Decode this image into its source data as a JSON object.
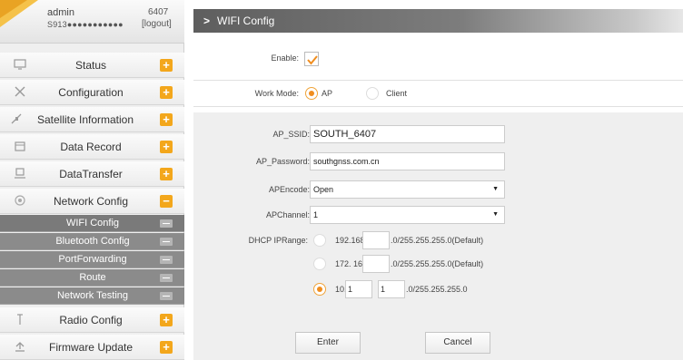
{
  "user": {
    "name": "admin",
    "serial": "S913●●●●●●●●●●●",
    "device_id": "6407",
    "logout_label": "[logout]"
  },
  "sidebar": {
    "items": [
      {
        "label": "Status",
        "icon": "monitor-icon"
      },
      {
        "label": "Configuration",
        "icon": "tools-icon"
      },
      {
        "label": "Satellite Information",
        "icon": "satellite-icon"
      },
      {
        "label": "Data Record",
        "icon": "calendar-icon"
      },
      {
        "label": "DataTransfer",
        "icon": "transfer-icon"
      },
      {
        "label": "Network Config",
        "icon": "globe-icon"
      }
    ],
    "subitems": [
      {
        "label": "WIFI Config"
      },
      {
        "label": "Bluetooth Config"
      },
      {
        "label": "PortForwarding"
      },
      {
        "label": "Route"
      },
      {
        "label": "Network Testing"
      }
    ],
    "bottom_items": [
      {
        "label": "Radio Config",
        "icon": "antenna-icon"
      },
      {
        "label": "Firmware Update",
        "icon": "upload-icon"
      }
    ]
  },
  "page": {
    "title": "WIFI Config",
    "enable_label": "Enable:",
    "enable_checked": true,
    "work_mode_label": "Work Mode:",
    "work_mode_options": [
      "AP",
      "Client"
    ],
    "work_mode_selected": "AP"
  },
  "form": {
    "ssid_label": "AP_SSID:",
    "ssid_value": "SOUTH_6407",
    "password_label": "AP_Password:",
    "password_value": "southgnss.com.cn",
    "encode_label": "APEncode:",
    "encode_value": "Open",
    "channel_label": "APChannel:",
    "channel_value": "1",
    "dhcp_label": "DHCP IPRange:",
    "dhcp_options": [
      {
        "prefix": "192.168.",
        "fields": [
          ""
        ],
        "suffix": ".0/255.255.255.0(Default)",
        "selected": false
      },
      {
        "prefix": "172. 16.",
        "fields": [
          ""
        ],
        "suffix": ".0/255.255.255.0(Default)",
        "selected": false
      },
      {
        "prefix": "10.",
        "fields": [
          "1",
          "1"
        ],
        "suffix": ".0/255.255.255.0",
        "selected": true
      }
    ]
  },
  "buttons": {
    "enter": "Enter",
    "cancel": "Cancel"
  },
  "colors": {
    "accent": "#f3a71c",
    "submenu_bg": "#8b8b8b",
    "title_bar": "#5e5e5e"
  }
}
